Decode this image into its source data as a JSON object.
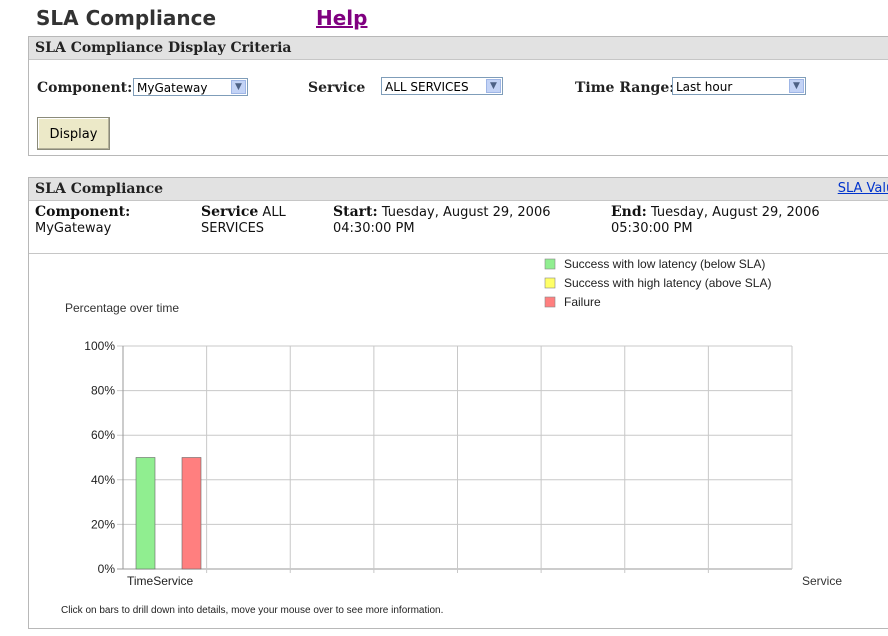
{
  "header": {
    "title": "SLA Compliance",
    "help": "Help"
  },
  "criteria": {
    "heading": "SLA Compliance Display Criteria",
    "component_label": "Component:",
    "component_value": "MyGateway",
    "service_label": "Service",
    "service_value": "ALL SERVICES",
    "time_range_label": "Time Range:",
    "time_range_value": "Last hour",
    "display_button": "Display"
  },
  "compliance": {
    "heading": "SLA Compliance",
    "sla_values_link": "SLA Values",
    "component_label": "Component:",
    "component_value": "MyGateway",
    "service_label": "Service",
    "service_value": "ALL SERVICES",
    "start_label": "Start:",
    "start_value": "Tuesday, August 29, 2006 04:30:00 PM",
    "end_label": "End:",
    "end_value": "Tuesday, August 29, 2006 05:30:00 PM",
    "footer_note": "Click on bars to drill down into details, move your mouse over to see more information."
  },
  "chart_data": {
    "type": "bar",
    "title": "Percentage over time",
    "xlabel": "Service",
    "ylabel": "",
    "ylim": [
      0,
      100
    ],
    "y_ticks": [
      "0%",
      "20%",
      "40%",
      "60%",
      "80%",
      "100%"
    ],
    "categories": [
      "TimeService"
    ],
    "series": [
      {
        "name": "Success with low latency (below SLA)",
        "color": "#90ee90",
        "values": [
          50
        ]
      },
      {
        "name": "Success with high latency (above SLA)",
        "color": "#ffff66",
        "values": [
          0
        ]
      },
      {
        "name": "Failure",
        "color": "#ff7f7f",
        "values": [
          50
        ]
      }
    ],
    "grid": true,
    "legend_position": "top-right"
  }
}
